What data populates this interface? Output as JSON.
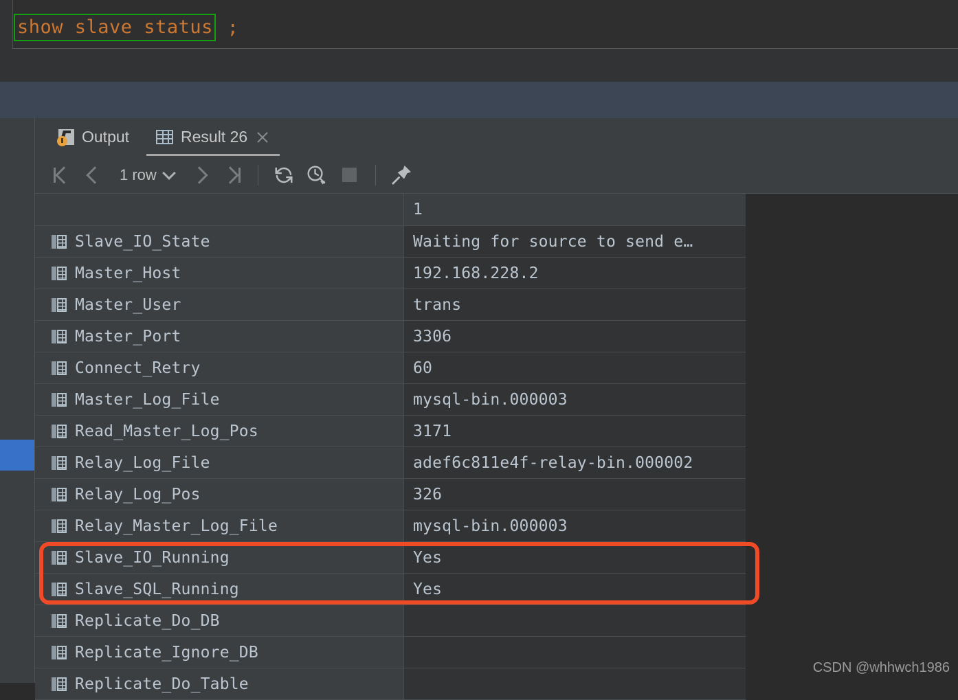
{
  "editor": {
    "selected_sql": "show slave status",
    "trailing_sql": " ;"
  },
  "tabs": [
    {
      "label": "Output",
      "icon": "output-icon",
      "active": false
    },
    {
      "label": "Result 26",
      "icon": "table-icon",
      "active": true,
      "closable": true
    }
  ],
  "toolbar": {
    "first_page": "first-page-icon",
    "prev_page": "previous-page-icon",
    "row_count": "1 row",
    "next_page": "next-page-icon",
    "last_page": "last-page-icon",
    "refresh": "refresh-icon",
    "history": "query-history-icon",
    "stop": "stop-icon",
    "pin": "pin-icon"
  },
  "grid": {
    "columns": [
      "",
      "1"
    ],
    "rows": [
      {
        "name": "Slave_IO_State",
        "value": "Waiting for source to send e…"
      },
      {
        "name": "Master_Host",
        "value": "192.168.228.2"
      },
      {
        "name": "Master_User",
        "value": "trans"
      },
      {
        "name": "Master_Port",
        "value": "3306"
      },
      {
        "name": "Connect_Retry",
        "value": "60"
      },
      {
        "name": "Master_Log_File",
        "value": "mysql-bin.000003"
      },
      {
        "name": "Read_Master_Log_Pos",
        "value": "3171"
      },
      {
        "name": "Relay_Log_File",
        "value": "adef6c811e4f-relay-bin.000002"
      },
      {
        "name": "Relay_Log_Pos",
        "value": "326"
      },
      {
        "name": "Relay_Master_Log_File",
        "value": "mysql-bin.000003"
      },
      {
        "name": "Slave_IO_Running",
        "value": "Yes"
      },
      {
        "name": "Slave_SQL_Running",
        "value": "Yes"
      },
      {
        "name": "Replicate_Do_DB",
        "value": ""
      },
      {
        "name": "Replicate_Ignore_DB",
        "value": ""
      },
      {
        "name": "Replicate_Do_Table",
        "value": ""
      }
    ]
  },
  "annotation": {
    "color": "#f04a27",
    "highlights": [
      "Slave_IO_Running",
      "Slave_SQL_Running"
    ]
  },
  "watermark": "CSDN @whhwch1986",
  "colors": {
    "sql_keyword": "#cc7832",
    "selection_outline": "#13a10e",
    "band_blue": "#3c4654",
    "marker_blue": "#3771c8",
    "panel": "#3c3f41",
    "value_cell": "#313335"
  }
}
